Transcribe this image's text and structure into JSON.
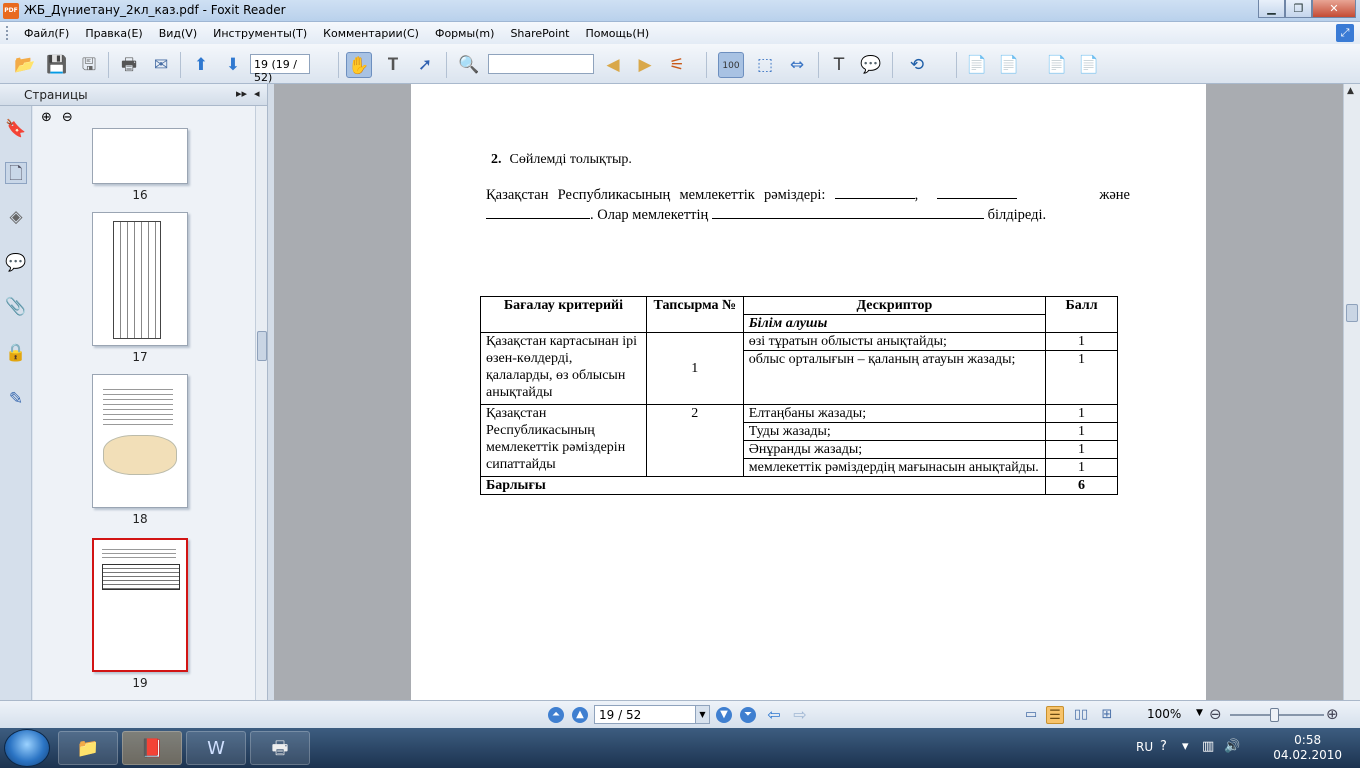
{
  "window": {
    "title": "ЖБ_Дүниетану_2кл_каз.pdf - Foxit Reader",
    "app_icon_text": "PDF"
  },
  "menu": [
    "Файл(F)",
    "Правка(E)",
    "Вид(V)",
    "Инструменты(T)",
    "Комментарии(C)",
    "Формы(m)",
    "SharePoint",
    "Помощь(H)"
  ],
  "toolbar": {
    "page_field": "19 (19 / 52)",
    "search_value": ""
  },
  "panel": {
    "title": "Страницы",
    "thumbnails": [
      {
        "num": "16"
      },
      {
        "num": "17"
      },
      {
        "num": "18"
      },
      {
        "num": "19",
        "selected": true
      }
    ]
  },
  "document": {
    "question_num": "2.",
    "question_text": "Сөйлемді толықтыр.",
    "sentence_part1": "Қазақстан Республикасының мемлекеттік рәміздері:",
    "sentence_comma": ",",
    "sentence_and": "және",
    "sentence_part2": ". Олар мемлекеттің",
    "sentence_end": "білдіреді.",
    "table": {
      "headers": {
        "criteria": "Бағалау критерийі",
        "task": "Тапсырма №",
        "descriptor": "Дескриптор",
        "score": "Балл",
        "learner": "Білім алушы"
      },
      "rows": [
        {
          "criteria": "Қазақстан картасынан ірі өзен-көлдерді, қалаларды, өз облысын анықтайды",
          "task": "1",
          "descriptors": [
            {
              "text": "өзі тұратын облысты анықтайды;",
              "score": "1"
            },
            {
              "text": "облыс орталығын – қаланың атауын жазады;",
              "score": "1"
            }
          ]
        },
        {
          "criteria": "Қазақстан Республикасының мемлекеттік рәміздерін сипаттайды",
          "task": "2",
          "descriptors": [
            {
              "text": "Елтаңбаны жазады;",
              "score": "1"
            },
            {
              "text": "Туды жазады;",
              "score": "1"
            },
            {
              "text": "Әнұранды жазады;",
              "score": "1"
            },
            {
              "text": "мемлекеттік рәміздердің мағынасын анықтайды.",
              "score": "1"
            }
          ]
        }
      ],
      "total_label": "Барлығы",
      "total_score": "6"
    }
  },
  "navbar": {
    "page_value": "19 / 52",
    "zoom": "100%"
  },
  "taskbar": {
    "lang": "RU",
    "time": "0:58",
    "date": "04.02.2010"
  }
}
